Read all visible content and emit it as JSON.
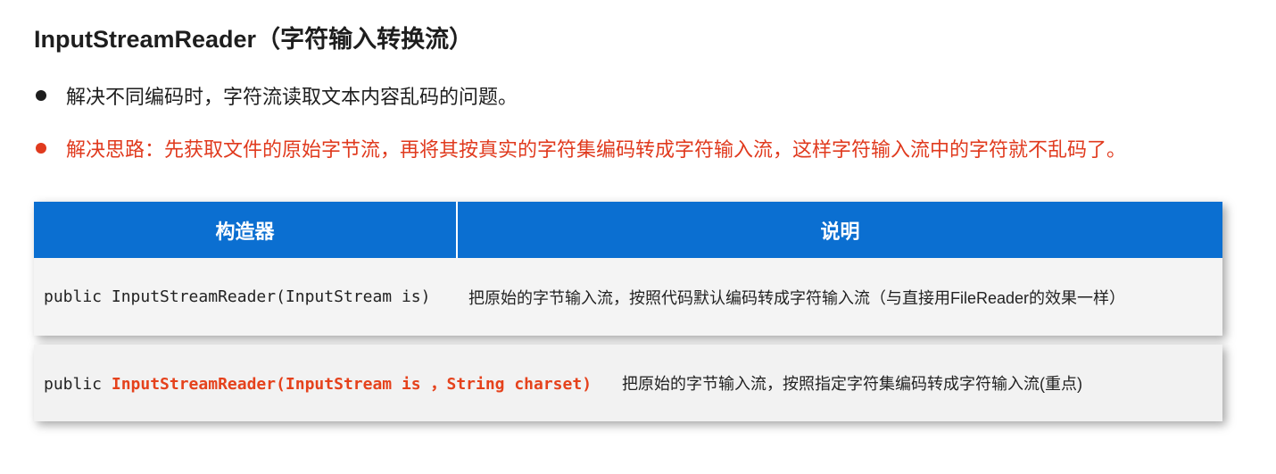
{
  "title": "InputStreamReader（字符输入转换流）",
  "bullets": [
    {
      "text": "解决不同编码时，字符流读取文本内容乱码的问题。",
      "color": "#1e1e1e"
    },
    {
      "text": "解决思路：先获取文件的原始字节流，再将其按真实的字符集编码转成字符输入流，这样字符输入流中的字符就不乱码了。",
      "color": "#e03a1e"
    }
  ],
  "table": {
    "header_color": "#0b6fd1",
    "headers": [
      "构造器",
      "说明"
    ],
    "rows": [
      {
        "prefix": "public ",
        "constructor": "InputStreamReader(InputStream is)",
        "description": "把原始的字节输入流，按照代码默认编码转成字符输入流（与直接用FileReader的效果一样）"
      },
      {
        "prefix": "public ",
        "constructor": "InputStreamReader(InputStream is ，String charset)",
        "description": "把原始的字节输入流，按照指定字符集编码转成字符输入流(重点)",
        "highlight_color": "#e5421c"
      }
    ]
  }
}
